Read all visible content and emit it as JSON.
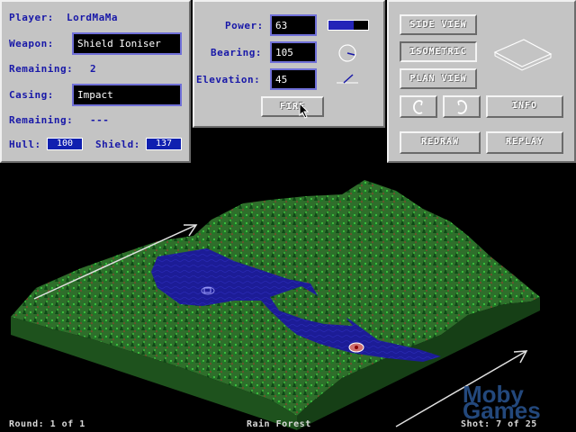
{
  "player_panel": {
    "player_label": "Player:",
    "player_name": "LordMaMa",
    "weapon_label": "Weapon:",
    "weapon_value": "Shield Ioniser",
    "weapon_remaining_label": "Remaining:",
    "weapon_remaining_value": "2",
    "casing_label": "Casing:",
    "casing_value": "Impact",
    "casing_remaining_label": "Remaining:",
    "casing_remaining_value": "---",
    "hull_label": "Hull:",
    "hull_value": "100",
    "shield_label": "Shield:",
    "shield_value": "137"
  },
  "aim_panel": {
    "power_label": "Power:",
    "power_value": "63",
    "power_level_percent": 63,
    "bearing_label": "Bearing:",
    "bearing_value": "105",
    "elevation_label": "Elevation:",
    "elevation_value": "45",
    "fire_label": "FIRE"
  },
  "view_panel": {
    "side_view_label": "SIDE VIEW",
    "isometric_label": "ISOMETRIC",
    "plan_view_label": "PLAN VIEW",
    "info_label": "INFO",
    "redraw_label": "REDRAW",
    "replay_label": "REPLAY"
  },
  "status_bar": {
    "round_text": "Round: 1 of 1",
    "map_name": "Rain Forest",
    "shot_text": "Shot: 7 of 25"
  },
  "watermark": {
    "line1": "Moby",
    "line2": "Games"
  },
  "colors": {
    "panel": "#c4c4c4",
    "label_blue": "#1818a8",
    "terrain_green": "#2e6a2a",
    "water_blue": "#1a1a90"
  },
  "icons": [
    "power-meter-icon",
    "bearing-dial-icon",
    "elevation-angle-icon",
    "isometric-cube-icon",
    "rotate-left-icon",
    "rotate-right-icon",
    "mouse-cursor-icon",
    "tank-target-icon"
  ]
}
